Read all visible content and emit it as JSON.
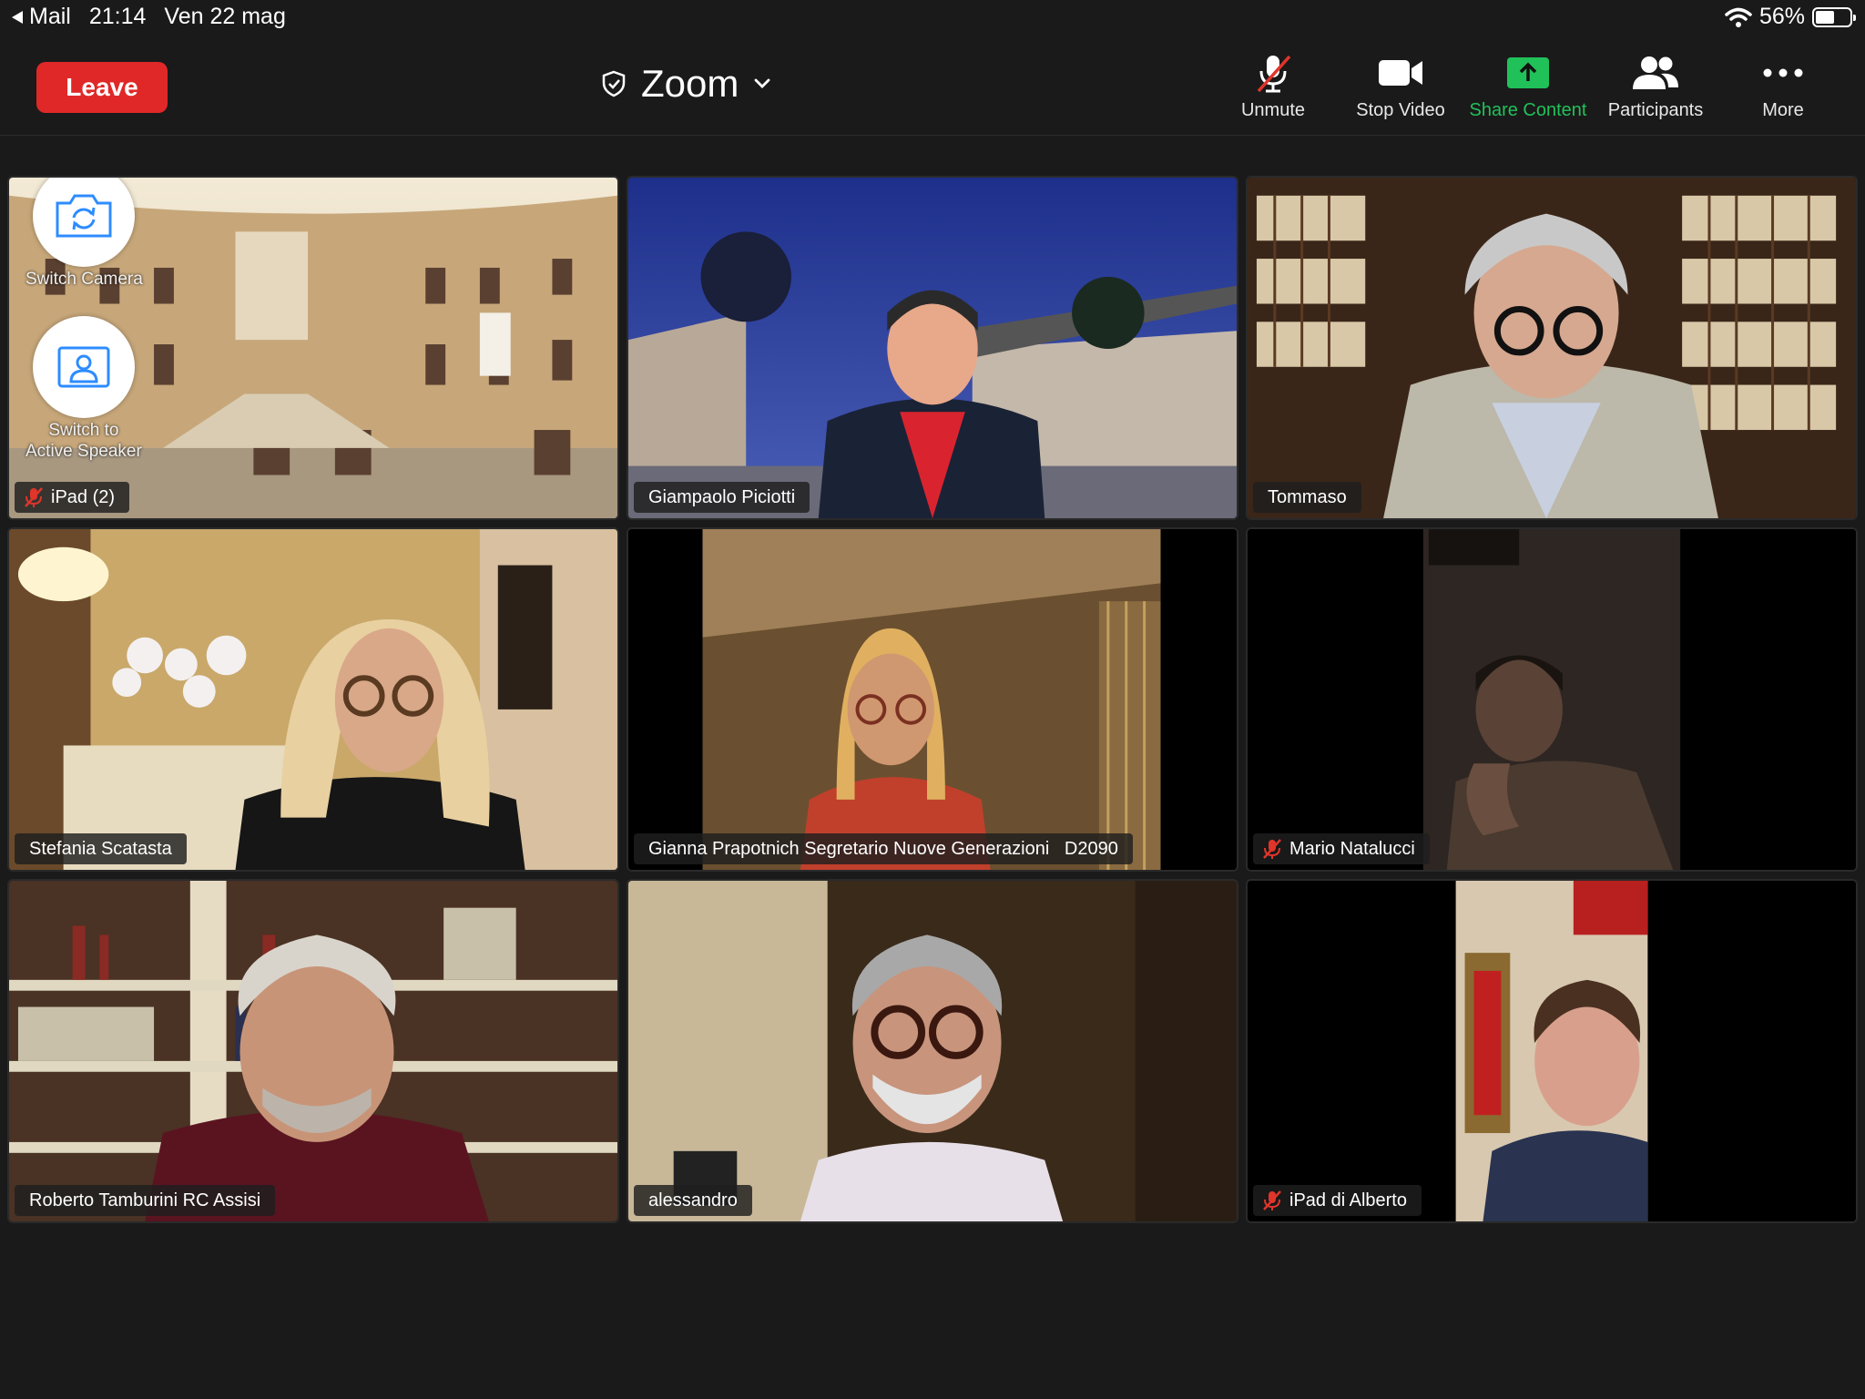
{
  "status": {
    "back_app": "Mail",
    "time": "21:14",
    "date": "Ven 22 mag",
    "battery_percent": "56%",
    "battery_level": 0.56
  },
  "toolbar": {
    "leave_label": "Leave",
    "title": "Zoom",
    "buttons": [
      {
        "label": "Unmute",
        "icon": "mic-muted-icon"
      },
      {
        "label": "Stop Video",
        "icon": "video-camera-icon"
      },
      {
        "label": "Share Content",
        "icon": "share-screen-icon"
      },
      {
        "label": "Participants",
        "icon": "participants-icon"
      },
      {
        "label": "More",
        "icon": "more-dots-icon"
      }
    ]
  },
  "overlay": {
    "switch_camera": "Switch Camera",
    "switch_speaker_1": "Switch to",
    "switch_speaker_2": "Active Speaker"
  },
  "participants": [
    {
      "name": "iPad (2)",
      "muted": true
    },
    {
      "name": "Giampaolo Piciotti",
      "muted": false
    },
    {
      "name": "Tommaso",
      "muted": false
    },
    {
      "name": "Stefania Scatasta",
      "muted": false
    },
    {
      "name": "Gianna Prapotnich Segretario Nuove Generazioni   D2090",
      "muted": false
    },
    {
      "name": "Mario Natalucci",
      "muted": true
    },
    {
      "name": "Roberto Tamburini RC Assisi",
      "muted": false
    },
    {
      "name": "alessandro",
      "muted": false
    },
    {
      "name": "iPad di Alberto",
      "muted": true
    }
  ],
  "colors": {
    "leave": "#e02828",
    "share_green": "#21c15a",
    "mute_red": "#e0352b",
    "background": "#1a1a1a"
  }
}
